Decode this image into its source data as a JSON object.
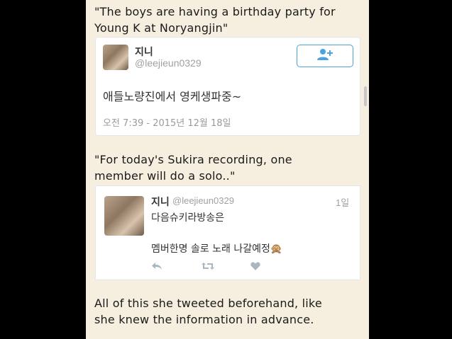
{
  "captions": {
    "top_line1": "\"The boys are having a birthday party for",
    "top_line2": "Young K at Noryangjin\"",
    "mid_line1": "\"For today's Sukira recording, one",
    "mid_line2": "member will do a solo..\"",
    "bottom_line1": "All of this she tweeted beforehand, like",
    "bottom_line2": "she knew the information in advance."
  },
  "tweet1": {
    "name": "지니",
    "handle": "@leejieun0329",
    "text": "애들노량진에서 영케생파중~",
    "date": "오전 7:39 - 2015년 12월 18일",
    "follow_icon": "add-user-icon"
  },
  "tweet2": {
    "name": "지니",
    "handle": "@leejieun0329",
    "age": "1일",
    "line1": "다음슈키라방송은",
    "line2": "멤버한명 솔로 노래 나갈예정🙊",
    "actions": [
      "reply-icon",
      "retweet-icon",
      "like-icon"
    ]
  },
  "colors": {
    "panel_bg": "#f6efe0",
    "accent": "#4aa3df",
    "icon_gray": "#a8b6c2"
  }
}
